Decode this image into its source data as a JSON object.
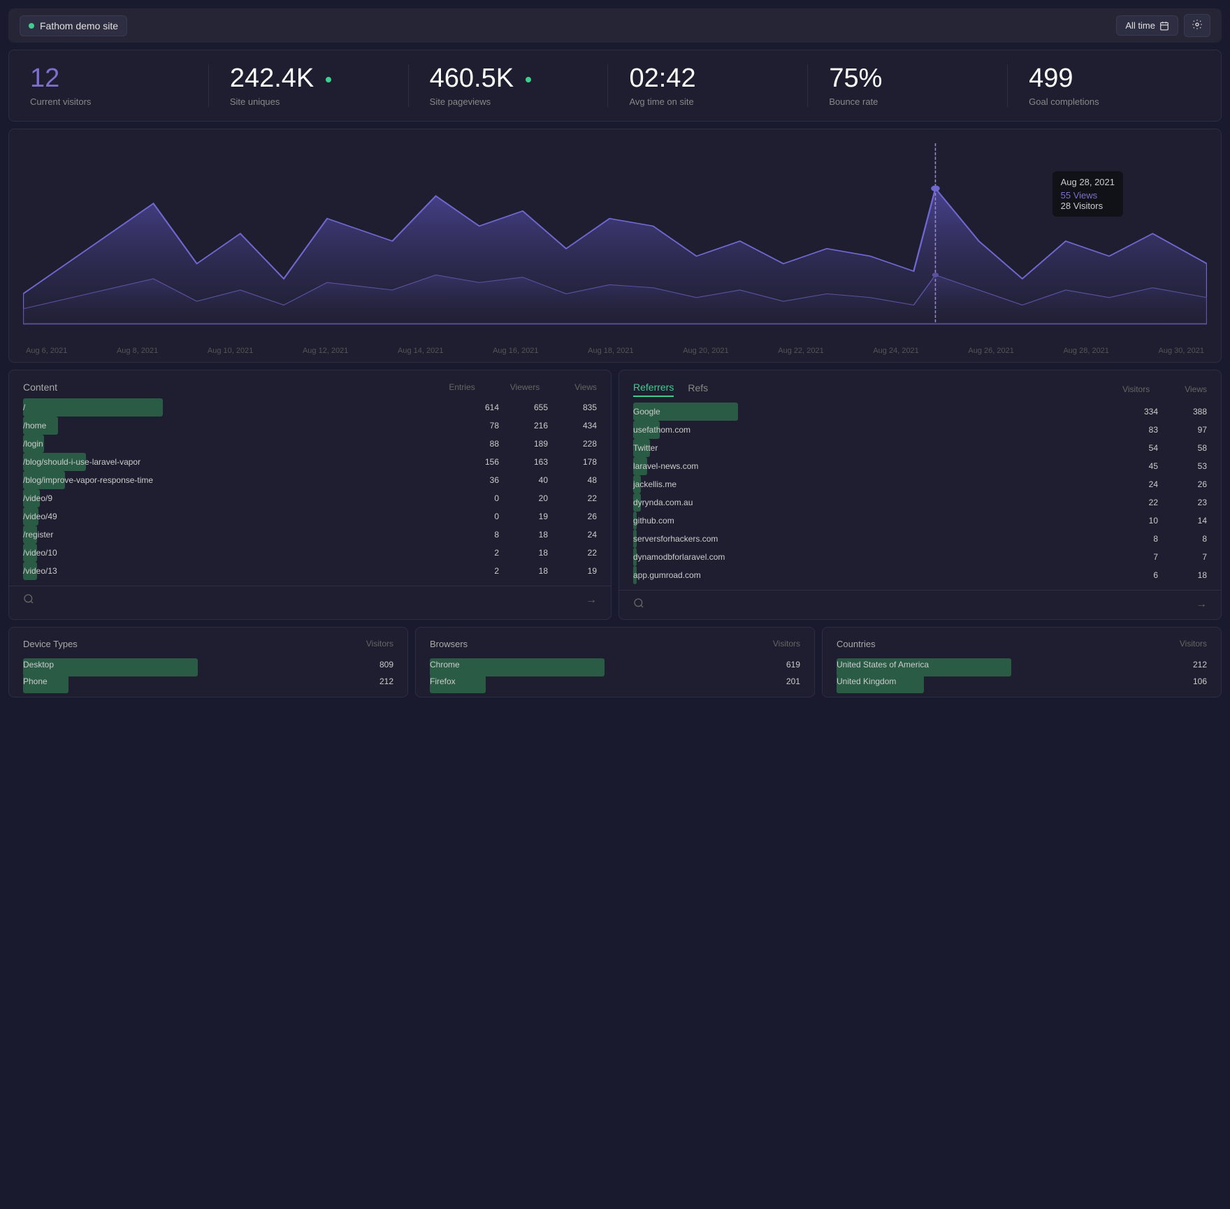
{
  "header": {
    "site_name": "Fathom demo site",
    "alltime_label": "All time",
    "site_dot_color": "#3ecf8e"
  },
  "stats": [
    {
      "id": "current-visitors",
      "value": "12",
      "label": "Current visitors",
      "accent": true
    },
    {
      "id": "site-uniques",
      "value": "242.4K",
      "label": "Site uniques",
      "dot": true
    },
    {
      "id": "site-pageviews",
      "value": "460.5K",
      "label": "Site pageviews",
      "dot": true
    },
    {
      "id": "avg-time",
      "value": "02:42",
      "label": "Avg time on site"
    },
    {
      "id": "bounce-rate",
      "value": "75%",
      "label": "Bounce rate"
    },
    {
      "id": "goal-completions",
      "value": "499",
      "label": "Goal completions"
    }
  ],
  "chart": {
    "tooltip": {
      "date": "Aug 28, 2021",
      "views_label": "55 Views",
      "visitors_label": "28 Visitors"
    },
    "x_labels": [
      "Aug 6, 2021",
      "Aug 8, 2021",
      "Aug 10, 2021",
      "Aug 12, 2021",
      "Aug 14, 2021",
      "Aug 16, 2021",
      "Aug 18, 2021",
      "Aug 20, 2021",
      "Aug 22, 2021",
      "Aug 24, 2021",
      "Aug 26, 2021",
      "Aug 28, 2021",
      "Aug 30, 2021"
    ]
  },
  "content_panel": {
    "title": "Content",
    "cols": [
      "Entries",
      "Viewers",
      "Views"
    ],
    "rows": [
      {
        "label": "/",
        "entries": "614",
        "viewers": "655",
        "views": "835",
        "bar_pct": 100
      },
      {
        "label": "/home",
        "entries": "78",
        "viewers": "216",
        "views": "434",
        "bar_pct": 25
      },
      {
        "label": "/login",
        "entries": "88",
        "viewers": "189",
        "views": "228",
        "bar_pct": 15
      },
      {
        "label": "/blog/should-i-use-laravel-vapor",
        "entries": "156",
        "viewers": "163",
        "views": "178",
        "bar_pct": 45
      },
      {
        "label": "/blog/improve-vapor-response-time",
        "entries": "36",
        "viewers": "40",
        "views": "48",
        "bar_pct": 30
      },
      {
        "label": "/video/9",
        "entries": "0",
        "viewers": "20",
        "views": "22",
        "bar_pct": 12
      },
      {
        "label": "/video/49",
        "entries": "0",
        "viewers": "19",
        "views": "26",
        "bar_pct": 11
      },
      {
        "label": "/register",
        "entries": "8",
        "viewers": "18",
        "views": "24",
        "bar_pct": 10
      },
      {
        "label": "/video/10",
        "entries": "2",
        "viewers": "18",
        "views": "22",
        "bar_pct": 10
      },
      {
        "label": "/video/13",
        "entries": "2",
        "viewers": "18",
        "views": "19",
        "bar_pct": 10
      }
    ]
  },
  "referrers_panel": {
    "tab_active": "Referrers",
    "tab_inactive": "Refs",
    "cols": [
      "Visitors",
      "Views"
    ],
    "rows": [
      {
        "label": "Google",
        "visitors": "334",
        "views": "388",
        "bar_pct": 100
      },
      {
        "label": "usefathom.com",
        "visitors": "83",
        "views": "97",
        "bar_pct": 25
      },
      {
        "label": "Twitter",
        "visitors": "54",
        "views": "58",
        "bar_pct": 16
      },
      {
        "label": "laravel-news.com",
        "visitors": "45",
        "views": "53",
        "bar_pct": 13
      },
      {
        "label": "jackellis.me",
        "visitors": "24",
        "views": "26",
        "bar_pct": 7
      },
      {
        "label": "dyrynda.com.au",
        "visitors": "22",
        "views": "23",
        "bar_pct": 7
      },
      {
        "label": "github.com",
        "visitors": "10",
        "views": "14",
        "bar_pct": 3
      },
      {
        "label": "serversforhackers.com",
        "visitors": "8",
        "views": "8",
        "bar_pct": 2
      },
      {
        "label": "dynamodbforlaravel.com",
        "visitors": "7",
        "views": "7",
        "bar_pct": 2
      },
      {
        "label": "app.gumroad.com",
        "visitors": "6",
        "views": "18",
        "bar_pct": 2
      }
    ]
  },
  "device_types": {
    "title": "Device Types",
    "col": "Visitors",
    "rows": [
      {
        "label": "Desktop",
        "value": "809",
        "bar_pct": 100
      },
      {
        "label": "Phone",
        "value": "212",
        "bar_pct": 26
      }
    ]
  },
  "browsers": {
    "title": "Browsers",
    "col": "Visitors",
    "rows": [
      {
        "label": "Chrome",
        "value": "619",
        "bar_pct": 100
      },
      {
        "label": "Firefox",
        "value": "201",
        "bar_pct": 32
      }
    ]
  },
  "countries": {
    "title": "Countries",
    "col": "Visitors",
    "rows": [
      {
        "label": "United States of America",
        "value": "212",
        "bar_pct": 100
      },
      {
        "label": "United Kingdom",
        "value": "106",
        "bar_pct": 50
      }
    ]
  }
}
